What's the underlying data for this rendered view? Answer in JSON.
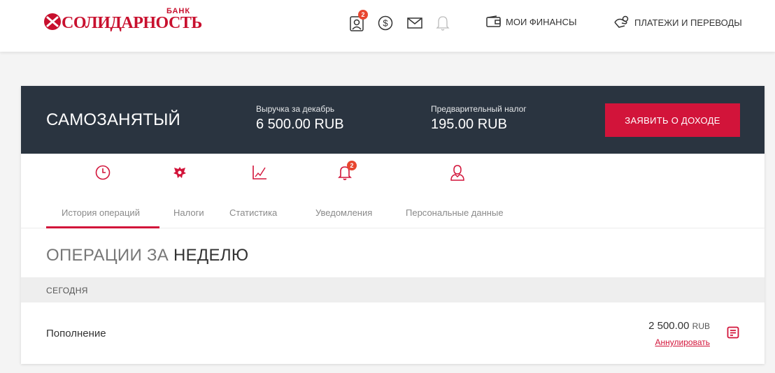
{
  "header": {
    "logo": {
      "bank_word": "БАНК",
      "brand_word": "СОЛИДАРНОСТЬ"
    },
    "icons": [
      {
        "name": "profile-icon",
        "badge": "2"
      },
      {
        "name": "currency-icon"
      },
      {
        "name": "mail-icon"
      },
      {
        "name": "bell-icon"
      }
    ],
    "finances_label": "МОИ ФИНАНСЫ",
    "payments_label": "ПЛАТЕЖИ И ПЕРЕВОДЫ"
  },
  "summary": {
    "title": "САМОЗАНЯТЫЙ",
    "revenue_label": "Выручка за декабрь",
    "revenue_value": "6 500.00 RUB",
    "tax_label": "Предварительный налог",
    "tax_value": "195.00 RUB",
    "declare_button": "ЗАЯВИТЬ О ДОХОДЕ"
  },
  "tabs": [
    {
      "label": "История операций",
      "icon": "clock-icon",
      "active": true
    },
    {
      "label": "Налоги",
      "icon": "emblem-icon",
      "active": false
    },
    {
      "label": "Статистика",
      "icon": "chart-icon",
      "active": false
    },
    {
      "label": "Уведомления",
      "icon": "bell-icon",
      "badge": "2",
      "active": false
    },
    {
      "label": "Персональные данные",
      "icon": "user-icon",
      "active": false
    }
  ],
  "operations": {
    "title_light": "ОПЕРАЦИИ ЗА",
    "title_bold": "НЕДЕЛЮ",
    "groups": [
      {
        "day": "СЕГОДНЯ",
        "items": [
          {
            "name": "Пополнение",
            "amount": "2 500.00",
            "currency": "RUB",
            "action": "Аннулировать"
          }
        ]
      }
    ]
  },
  "colors": {
    "accent": "#d2143a",
    "band": "#2a3440",
    "badge": "#e8462f"
  }
}
